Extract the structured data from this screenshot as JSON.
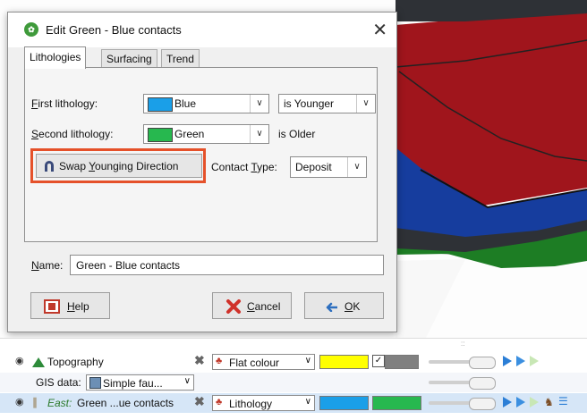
{
  "dialog": {
    "title": "Edit Green - Blue contacts",
    "close_glyph": "✕",
    "tabs": [
      {
        "label": "Lithologies",
        "active": true
      },
      {
        "label": "Surfacing",
        "active": false
      },
      {
        "label": "Trend",
        "active": false
      }
    ],
    "first_lithology": {
      "label_underlined": "F",
      "label_rest": "irst lithology:",
      "value": "Blue",
      "color": "#1a9fe8"
    },
    "first_relation": {
      "value": "is Younger"
    },
    "second_lithology": {
      "label_underlined": "S",
      "label_rest": "econd lithology:",
      "value": "Green",
      "color": "#27b84f"
    },
    "second_relation": {
      "value": "is Older"
    },
    "swap_button": {
      "text_before": "Swap ",
      "text_underlined": "Y",
      "text_after": "ounging Direction"
    },
    "contact_type": {
      "label_before": "Contact ",
      "label_underlined": "T",
      "label_after": "ype:",
      "value": "Deposit"
    },
    "name": {
      "label_underlined": "N",
      "label_rest": "ame:",
      "value": "Green - Blue contacts"
    },
    "help_button": {
      "underlined": "H",
      "rest": "elp"
    },
    "cancel_button": {
      "underlined": "C",
      "rest": "ancel"
    },
    "ok_button": {
      "underlined": "O",
      "rest": "K"
    }
  },
  "scene_colors": {
    "red": "#a0151c",
    "blue": "#163d9e",
    "green": "#1d7d24",
    "dark": "#2e3136"
  },
  "layers": [
    {
      "name": "Topography",
      "icon": "topography-icon",
      "mode": "Flat colour",
      "color1": "#ffff00",
      "checkbox_checked": true,
      "color2": "#808080"
    },
    {
      "label": "GIS data:",
      "value": "Simple fau..."
    },
    {
      "prefix": "East:",
      "name": "Green ...ue contacts",
      "mode": "Lithology",
      "color1": "#1a9fe8",
      "color2": "#27b84f"
    }
  ],
  "drag_handle": "::"
}
